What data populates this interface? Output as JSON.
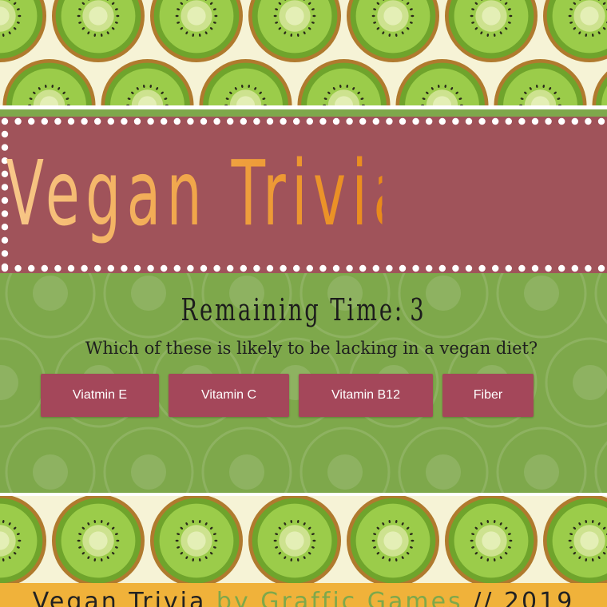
{
  "game": {
    "title": "Vegan Trivia",
    "timer_label": "Remaining Time:",
    "timer_value": "3",
    "question": "Which of these is likely to be lacking in a vegan diet?",
    "answers": [
      {
        "label": "Viatmin E"
      },
      {
        "label": "Vitamin C"
      },
      {
        "label": "Vitamin B12"
      },
      {
        "label": "Fiber"
      }
    ]
  },
  "footer": {
    "app_name": "Vegan Trivia",
    "credit": "by Graffic Games",
    "year_text": "// 2019"
  },
  "colors": {
    "background_cream": "#f6f3d6",
    "panel_green": "#7ea84b",
    "banner_maroon": "#a0535a",
    "button_maroon": "#a4475a",
    "title_orange": "#e98a1a",
    "footer_gold": "#f0b23a",
    "kiwi_green": "#8dc63f"
  }
}
